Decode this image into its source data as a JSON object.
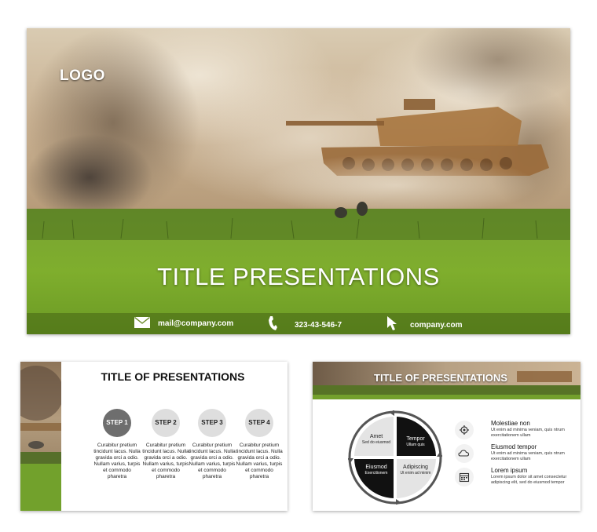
{
  "main_slide": {
    "logo": "LOGO",
    "title": "TITLE PRESENTATIONS",
    "footer": {
      "email": "mail@company.com",
      "phone": "323-43-546-7",
      "website": "company.com"
    }
  },
  "steps_slide": {
    "title": "TITLE OF PRESENTATIONS",
    "steps": [
      {
        "label": "STEP 1",
        "text": "Curabitur pretium tincidunt lacus. Nulla gravida orci a odio. Nullam varius, turpis et commodo pharetra"
      },
      {
        "label": "STEP 2",
        "text": "Curabitur pretium tincidunt lacus. Nulla gravida orci a odio. Nullam varius, turpis et commodo pharetra"
      },
      {
        "label": "STEP 3",
        "text": "Curabitur pretium tincidunt lacus. Nulla gravida orci a odio. Nullam varius, turpis et commodo pharetra"
      },
      {
        "label": "STEP 4",
        "text": "Curabitur pretium tincidunt lacus. Nulla gravida orci a odio. Nullam varius, turpis et commodo pharetra"
      }
    ]
  },
  "cycle_slide": {
    "title": "TITLE OF PRESENTATIONS",
    "quadrants": [
      {
        "title": "Amet",
        "sub": "Sed do eiusmod"
      },
      {
        "title": "Tempor",
        "sub": "Ullam quis"
      },
      {
        "title": "Eiusmod",
        "sub": "Exercitionem"
      },
      {
        "title": "Adipiscing",
        "sub": "Ut enim ad minim"
      }
    ],
    "legend": [
      {
        "icon": "gear-icon",
        "title": "Molestiae non",
        "desc": "Ut enim ad minima veniam, quis ntrum exercitationem ullam"
      },
      {
        "icon": "cloud-icon",
        "title": "Eiusmod tempor",
        "desc": "Ut enim ad minima veniam, quis ntrum exercitationem ullam"
      },
      {
        "icon": "calendar-icon",
        "title": "Lorem ipsum",
        "desc": "Lorem ipsum dolor sit amet consectetur adipiscing elit, sed do eiusmod tempor"
      }
    ]
  }
}
